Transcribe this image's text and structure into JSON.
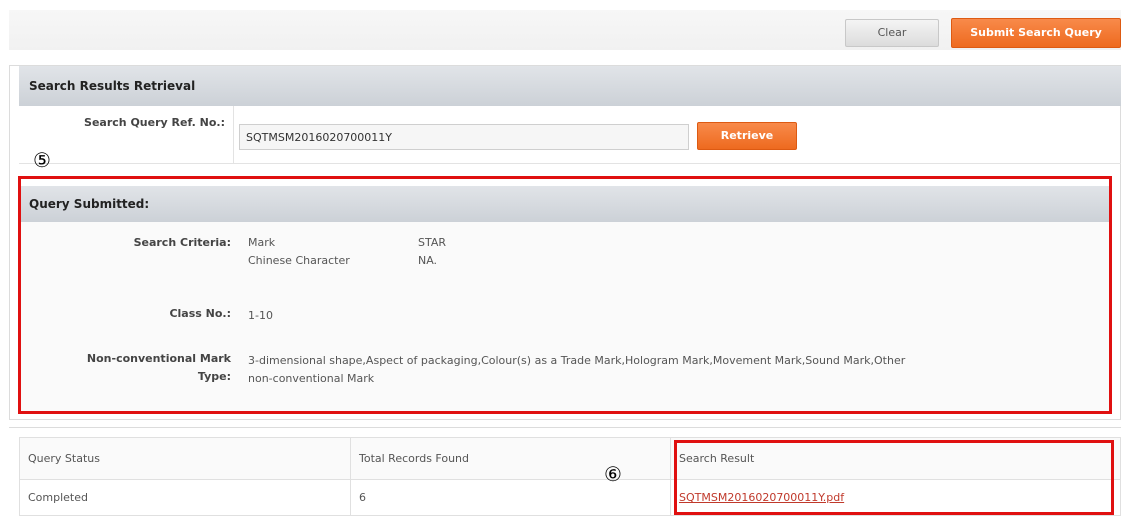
{
  "toolbar": {
    "clear_label": "Clear",
    "submit_label": "Submit Search Query"
  },
  "retrieval": {
    "title": "Search Results Retrieval",
    "ref_label": "Search Query Ref. No.:",
    "ref_value": "SQTMSM2016020700011Y",
    "retrieve_label": "Retrieve"
  },
  "markers": {
    "five": "⑤",
    "six": "⑥"
  },
  "query": {
    "title": "Query Submitted:",
    "criteria_label": "Search Criteria:",
    "criteria": [
      {
        "field": "Mark",
        "value": "STAR"
      },
      {
        "field": "Chinese Character",
        "value": "NA."
      }
    ],
    "class_label": "Class No.:",
    "class_value": "1-10",
    "ncm_label_line1": "Non-conventional Mark",
    "ncm_label_line2": "Type:",
    "ncm_value_line1": "3-dimensional shape,Aspect of packaging,Colour(s) as a Trade Mark,Hologram Mark,Movement Mark,Sound Mark,Other",
    "ncm_value_line2": "non-conventional Mark"
  },
  "results": {
    "headers": [
      "Query Status",
      "Total Records Found",
      "Search Result"
    ],
    "row": {
      "status": "Completed",
      "total": "6",
      "file": "SQTMSM2016020700011Y.pdf"
    }
  },
  "colors": {
    "accent_orange": "#f07a30",
    "annotation_red": "#e01010",
    "header_gray": "#d3d7dc",
    "link_red": "#c0392b"
  }
}
